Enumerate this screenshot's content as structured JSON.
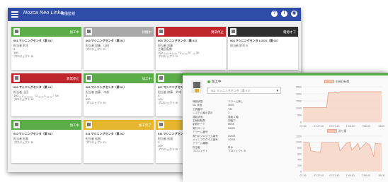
{
  "header": {
    "brand": "Nozca Neo Linka",
    "title": "稼働監視",
    "icons": [
      "help-icon",
      "info-icon",
      "user-icon"
    ],
    "icon_glyphs": [
      "?",
      "i",
      "◉"
    ]
  },
  "colors": {
    "header": "#2f4da8",
    "running": "#5cad4a",
    "stopped": "#a9a9a9",
    "alarm": "#c0262d",
    "power_off": "#2f2f2f",
    "setup": "#e5b62f"
  },
  "cards": [
    {
      "status": "加工中",
      "color": "#5cad4a",
      "name": "001 マシニングセンタ（第 01）",
      "lines": [
        "担当者 鈴木",
        "3",
        "100",
        "プロジェクト B"
      ]
    },
    {
      "status": "待機中",
      "color": "#a9a9a9",
      "name": "002 マシニングセンタ（第 01）",
      "lines": [
        "担当者 加藤、山田",
        "プロジェクト D"
      ]
    },
    {
      "status": "異常停止",
      "color": "#c0262d",
      "name": "003 マシニングセンタ（第 01）",
      "lines": [
        "担当者 加藤",
        "主軸回転数",
        "100 ▁ ▁ 1 ▁ ▁（1 ▁ ▁ 3） ▁ 30",
        "プロジェクト D"
      ]
    },
    {
      "status": "電源オフ",
      "color": "#2f2f2f",
      "name": "004 マシニングセンタ LOCO（第 01）",
      "lines": [
        "担当者 鈴木 B"
      ]
    },
    {
      "status": "異常停止",
      "color": "#c0262d",
      "name": "005 マシニングセンタ（第 01）",
      "lines": [
        "担当者 山田",
        "100 ▁ 2 ▁ ▁ ▁ （1 ▁ ▁ 1 ▁ ▁ ）00",
        "プロジェクト B"
      ]
    },
    {
      "status": "加工中",
      "color": "#5cad4a",
      "name": "006 マシニングセンタ（第 01）",
      "lines": [
        "担当者 加藤、木部",
        "3",
        "100",
        "プロジェクト B"
      ]
    },
    {
      "status": "加工中",
      "color": "#5cad4a",
      "name": "007 マシニングセンタ（第 01）",
      "lines": [
        "担当者 加藤、鈴木",
        "3",
        "100",
        "プロジェクト B"
      ]
    },
    {
      "status": "",
      "color": "#5cad4a",
      "name": "",
      "lines": []
    },
    {
      "status": "加工中",
      "color": "#5cad4a",
      "name": "010 マシニングセンタ（第 01）",
      "lines": [
        "担当者 松島",
        "プロジェクト B"
      ]
    },
    {
      "status": "加工完了",
      "color": "#e5b62f",
      "name": "011 マシニングセンタ（第 01）",
      "lines": [
        "担当者 松島",
        "プロジェクト D"
      ]
    },
    {
      "status": "加工完了",
      "color": "#e5b62f",
      "name": "011 マシニングセンタ（第 01）",
      "lines": [
        "担当者 松島",
        "3",
        "100",
        "プロジェクト B"
      ]
    }
  ],
  "detail": {
    "status": "加工中",
    "selector": "001 マシニングセンタ（第 01）",
    "props": [
      [
        "稼働状態",
        "アラーム無し"
      ],
      [
        "NC 状態",
        "3000"
      ],
      [
        "工具番号",
        "T22"
      ],
      [
        "システム軸の表示",
        "3"
      ],
      [
        "運転状態",
        "運転 2 軸"
      ],
      [
        "主軸回転数",
        "回転中"
      ],
      [
        "制御モード",
        "MEM"
      ],
      [
        "実行コード",
        "00001"
      ],
      [
        "アラーム番号",
        ""
      ],
      [
        "実行中プログラム番号",
        "O0001"
      ],
      [
        "メインプログラム番号",
        "O2001"
      ],
      [
        "アラーム種類",
        ""
      ],
      [
        "担当者",
        "鈴木"
      ],
      [
        "プロジェクト",
        "プロジェクト B"
      ]
    ]
  },
  "chart_data": [
    {
      "type": "area",
      "title": "",
      "legend": "主軸回転数",
      "x_ticks": [
        "07:16",
        "07:27:10",
        "07:37:40",
        "7:48:10",
        "7:58:40",
        "08:09"
      ],
      "ylim": [
        0,
        2500
      ],
      "y_ticks": [
        0,
        500,
        1000,
        1500,
        2000,
        2500
      ],
      "x": [
        0,
        0.3,
        0.32,
        0.45,
        0.47,
        1.0
      ],
      "values": [
        1020,
        1020,
        2080,
        2080,
        2150,
        2150
      ]
    },
    {
      "type": "area",
      "title": "",
      "legend": "送り量",
      "x_ticks": [
        "07:16",
        "07:27:10",
        "07:37:40",
        "7:48:10",
        "7:58:40",
        "08:09"
      ],
      "ylim": [
        0,
        1200
      ],
      "y_ticks": [
        0,
        200,
        400,
        600,
        800,
        1000,
        1200
      ],
      "x": [
        0,
        0.08,
        0.1,
        0.22,
        0.24,
        0.45,
        0.47,
        0.55,
        0.6,
        0.62,
        0.7,
        0.72,
        0.8,
        0.85,
        0.9,
        0.92,
        1.0
      ],
      "values": [
        1000,
        980,
        700,
        650,
        980,
        980,
        700,
        950,
        1000,
        720,
        960,
        740,
        980,
        900,
        500,
        950,
        940
      ]
    }
  ]
}
